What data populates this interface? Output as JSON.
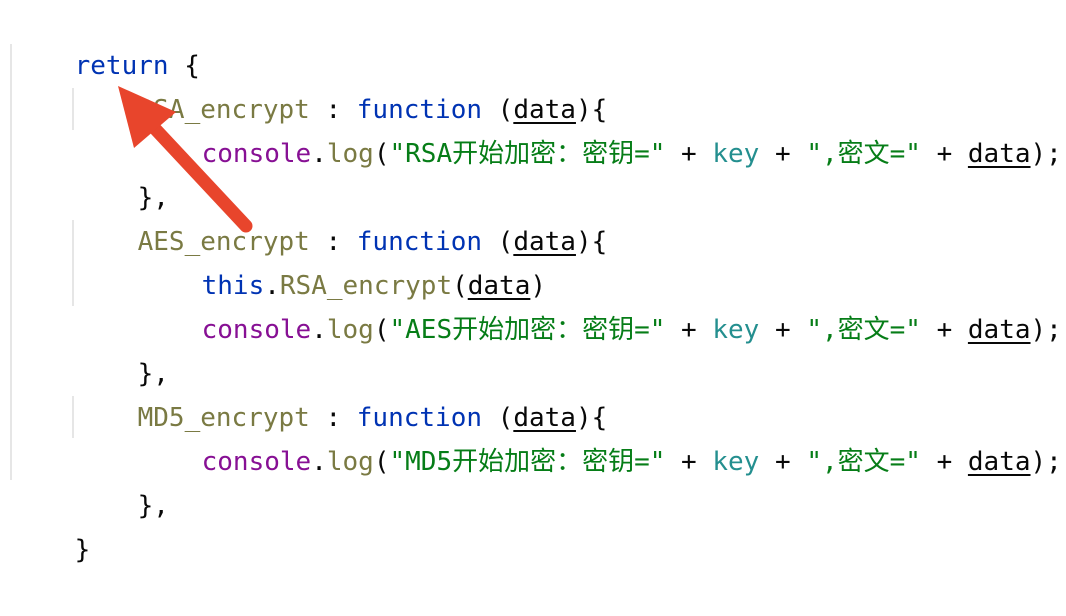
{
  "code": {
    "l1": {
      "kw": "return",
      "brace": " {"
    },
    "l2": {
      "name": "RSA_encrypt",
      "sep": " : ",
      "fn": "function",
      "open": " (",
      "param": "data",
      "close": "){"
    },
    "l3": {
      "obj": "console",
      "dot": ".",
      "meth": "log",
      "p1": "(",
      "str1": "\"RSA开始加密：密钥=\"",
      "op1": " + ",
      "key": "key",
      "op2": " + ",
      "str2": "\",密文=\"",
      "op3": " + ",
      "param": "data",
      "end": ");"
    },
    "l4": {
      "text": "},"
    },
    "l5": {
      "name": "AES_encrypt",
      "sep": " : ",
      "fn": "function",
      "open": " (",
      "param": "data",
      "close": "){"
    },
    "l6": {
      "kw": "this",
      "dot": ".",
      "call": "RSA_encrypt",
      "p1": "(",
      "param": "data",
      "p2": ")"
    },
    "l7": {
      "obj": "console",
      "dot": ".",
      "meth": "log",
      "p1": "(",
      "str1": "\"AES开始加密：密钥=\"",
      "op1": " + ",
      "key": "key",
      "op2": " + ",
      "str2": "\",密文=\"",
      "op3": " + ",
      "param": "data",
      "end": ");"
    },
    "l8": {
      "text": "},"
    },
    "l9": {
      "name": "MD5_encrypt",
      "sep": " : ",
      "fn": "function",
      "open": " (",
      "param": "data",
      "close": "){"
    },
    "l10": {
      "obj": "console",
      "dot": ".",
      "meth": "log",
      "p1": "(",
      "str1": "\"MD5开始加密：密钥=\"",
      "op1": " + ",
      "key": "key",
      "op2": " + ",
      "str2": "\",密文=\"",
      "op3": " + ",
      "param": "data",
      "end": ");"
    },
    "l11": {
      "text": "},"
    },
    "l12": {
      "text": "}"
    }
  },
  "colors": {
    "keyword": "#0033b3",
    "property": "#7a7a43",
    "object": "#871094",
    "string": "#067d17",
    "variable": "#248f8f",
    "annotation_arrow": "#e8452c"
  }
}
